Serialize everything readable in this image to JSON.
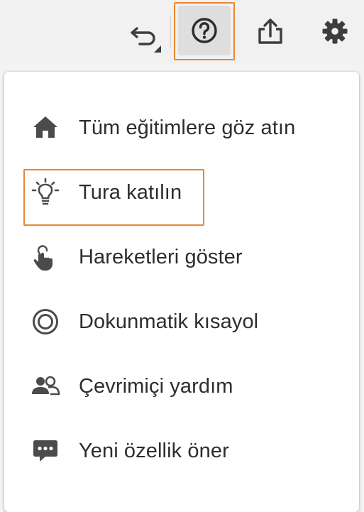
{
  "toolbar": {
    "undo_icon": "undo-icon",
    "help_icon": "help-circle-icon",
    "share_icon": "share-icon",
    "settings_icon": "gear-icon",
    "highlight_color": "#e8862f"
  },
  "menu": {
    "items": [
      {
        "label": "Tüm eğitimlere göz atın",
        "icon": "home-icon"
      },
      {
        "label": "Tura katılın",
        "icon": "lightbulb-icon"
      },
      {
        "label": "Hareketleri göster",
        "icon": "gesture-hand-icon"
      },
      {
        "label": "Dokunmatik kısayol",
        "icon": "touch-shortcut-icon"
      },
      {
        "label": "Çevrimiçi yardım",
        "icon": "users-icon"
      },
      {
        "label": "Yeni özellik öner",
        "icon": "chat-bubble-icon"
      }
    ]
  }
}
